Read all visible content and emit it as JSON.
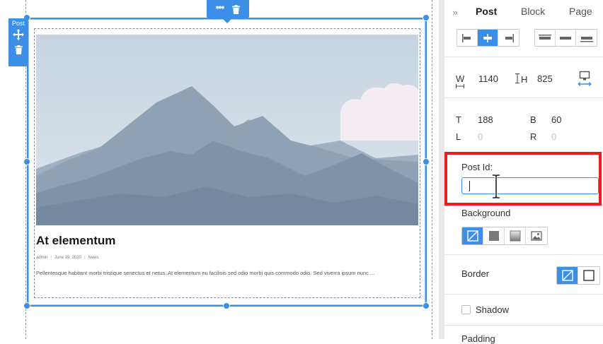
{
  "canvas": {
    "element_label": "Post",
    "post": {
      "title": "At elementum",
      "meta": {
        "author": "admin",
        "date": "June 19, 2020",
        "category": "News"
      },
      "excerpt": "Pellentesque habitant morbi tristique senectus et netus. At elementum eu facilisis sed odio morbi quis commodo odio. Sed viverra ipsum nunc ..."
    }
  },
  "panel": {
    "tabs": {
      "expand_icon": "»",
      "items": [
        "Post",
        "Block",
        "Page"
      ],
      "active": "Post"
    },
    "size": {
      "width_label": "W",
      "width_value": "1140",
      "height_label": "H",
      "height_value": "825"
    },
    "position": {
      "top_label": "T",
      "top_value": "188",
      "bottom_label": "B",
      "bottom_value": "60",
      "left_label": "L",
      "left_value": "0",
      "right_label": "R",
      "right_value": "0"
    },
    "post_id": {
      "label": "Post Id:",
      "value": ""
    },
    "background": {
      "label": "Background"
    },
    "border": {
      "label": "Border"
    },
    "shadow": {
      "label": "Shadow",
      "checked": false
    },
    "next_section": {
      "label": "Padding"
    }
  },
  "colors": {
    "accent": "#3b8fe6",
    "highlight": "#ee1c1c"
  }
}
